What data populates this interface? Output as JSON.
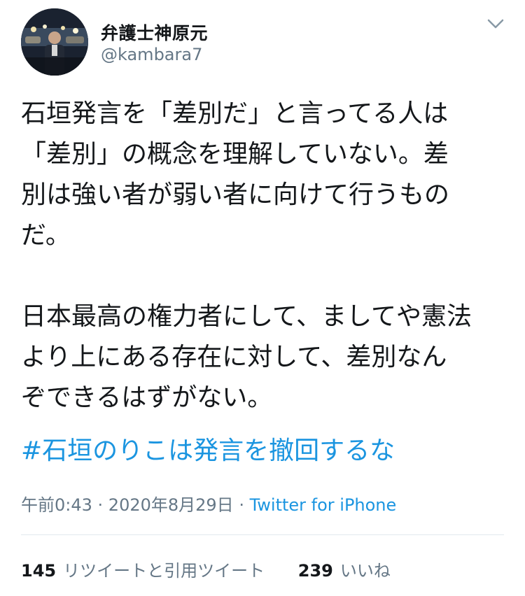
{
  "author": {
    "display_name": "弁護士神原元",
    "handle": "@kambara7",
    "avatar_icon": "profile-photo-night-street"
  },
  "menu_icon": "chevron-down-icon",
  "tweet": {
    "paragraph1_lines": [
      "石垣発言を「差別だ」と言ってる人は",
      "「差別」の概念を理解していない。差",
      "別は強い者が弱い者に向けて行うもの",
      "だ。"
    ],
    "paragraph2_lines": [
      "日本最高の権力者にして、ましてや憲法",
      "より上にある存在に対して、差別なん",
      "ぞできるはずがない。"
    ],
    "hashtag": "#石垣のりこは発言を撤回するな"
  },
  "meta": {
    "time": "午前0:43",
    "separator1": " · ",
    "date": "2020年8月29日",
    "separator2": " · ",
    "source": "Twitter for iPhone"
  },
  "stats": {
    "retweets_count": "145",
    "retweets_label": "リツイートと引用ツイート",
    "likes_count": "239",
    "likes_label": "いいね"
  },
  "colors": {
    "link": "#1b95e0",
    "secondary_text": "#657786",
    "primary_text": "#14171a",
    "divider": "#e1e8ed"
  }
}
